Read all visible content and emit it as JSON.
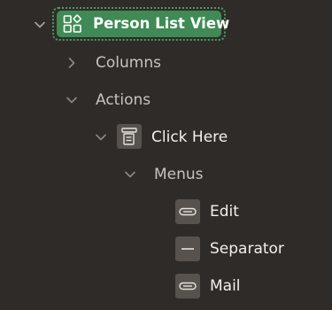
{
  "tree": {
    "root": {
      "label": "Person List View",
      "icon": "page-layout-icon",
      "expanded": true,
      "selected": true,
      "accent_color": "#3f8a55"
    },
    "columns": {
      "label": "Columns",
      "expanded": false
    },
    "actions": {
      "label": "Actions",
      "expanded": true,
      "click_here": {
        "label": "Click Here",
        "icon": "button-region-icon",
        "expanded": true,
        "menus": {
          "label": "Menus",
          "expanded": true,
          "items": [
            {
              "label": "Edit",
              "icon": "menu-entry-icon"
            },
            {
              "label": "Separator",
              "icon": "separator-icon"
            },
            {
              "label": "Mail",
              "icon": "menu-entry-icon"
            }
          ]
        }
      }
    }
  }
}
